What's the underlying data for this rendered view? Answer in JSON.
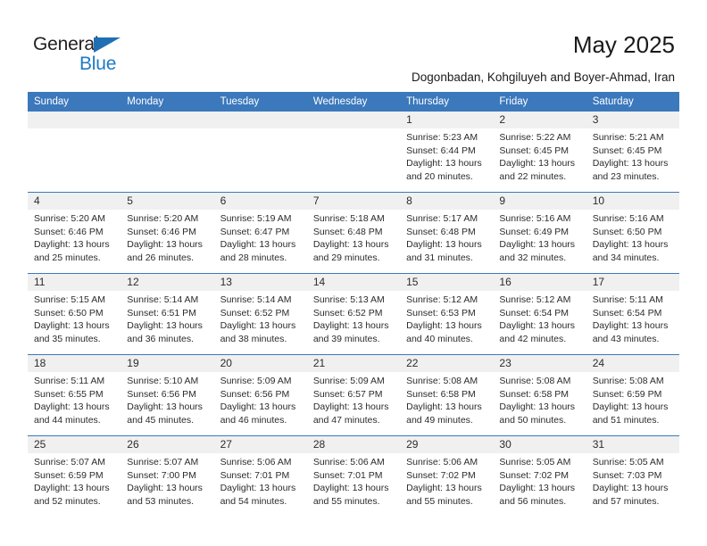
{
  "brand": {
    "name_top": "General",
    "name_bottom": "Blue",
    "accent_color": "#1f7ac4",
    "triangle_color": "#1f6fb5"
  },
  "header": {
    "title": "May 2025",
    "subtitle": "Dogonbadan, Kohgiluyeh and Boyer-Ahmad, Iran"
  },
  "calendar": {
    "header_bg": "#3b78bc",
    "daycell_bg": "#f0f0f0",
    "weekdays": [
      "Sunday",
      "Monday",
      "Tuesday",
      "Wednesday",
      "Thursday",
      "Friday",
      "Saturday"
    ],
    "weeks": [
      [
        {
          "day": "",
          "sunrise": "",
          "sunset": "",
          "daylight": "",
          "empty": true
        },
        {
          "day": "",
          "sunrise": "",
          "sunset": "",
          "daylight": "",
          "empty": true
        },
        {
          "day": "",
          "sunrise": "",
          "sunset": "",
          "daylight": "",
          "empty": true
        },
        {
          "day": "",
          "sunrise": "",
          "sunset": "",
          "daylight": "",
          "empty": true
        },
        {
          "day": "1",
          "sunrise": "Sunrise: 5:23 AM",
          "sunset": "Sunset: 6:44 PM",
          "daylight": "Daylight: 13 hours and 20 minutes."
        },
        {
          "day": "2",
          "sunrise": "Sunrise: 5:22 AM",
          "sunset": "Sunset: 6:45 PM",
          "daylight": "Daylight: 13 hours and 22 minutes."
        },
        {
          "day": "3",
          "sunrise": "Sunrise: 5:21 AM",
          "sunset": "Sunset: 6:45 PM",
          "daylight": "Daylight: 13 hours and 23 minutes."
        }
      ],
      [
        {
          "day": "4",
          "sunrise": "Sunrise: 5:20 AM",
          "sunset": "Sunset: 6:46 PM",
          "daylight": "Daylight: 13 hours and 25 minutes."
        },
        {
          "day": "5",
          "sunrise": "Sunrise: 5:20 AM",
          "sunset": "Sunset: 6:46 PM",
          "daylight": "Daylight: 13 hours and 26 minutes."
        },
        {
          "day": "6",
          "sunrise": "Sunrise: 5:19 AM",
          "sunset": "Sunset: 6:47 PM",
          "daylight": "Daylight: 13 hours and 28 minutes."
        },
        {
          "day": "7",
          "sunrise": "Sunrise: 5:18 AM",
          "sunset": "Sunset: 6:48 PM",
          "daylight": "Daylight: 13 hours and 29 minutes."
        },
        {
          "day": "8",
          "sunrise": "Sunrise: 5:17 AM",
          "sunset": "Sunset: 6:48 PM",
          "daylight": "Daylight: 13 hours and 31 minutes."
        },
        {
          "day": "9",
          "sunrise": "Sunrise: 5:16 AM",
          "sunset": "Sunset: 6:49 PM",
          "daylight": "Daylight: 13 hours and 32 minutes."
        },
        {
          "day": "10",
          "sunrise": "Sunrise: 5:16 AM",
          "sunset": "Sunset: 6:50 PM",
          "daylight": "Daylight: 13 hours and 34 minutes."
        }
      ],
      [
        {
          "day": "11",
          "sunrise": "Sunrise: 5:15 AM",
          "sunset": "Sunset: 6:50 PM",
          "daylight": "Daylight: 13 hours and 35 minutes."
        },
        {
          "day": "12",
          "sunrise": "Sunrise: 5:14 AM",
          "sunset": "Sunset: 6:51 PM",
          "daylight": "Daylight: 13 hours and 36 minutes."
        },
        {
          "day": "13",
          "sunrise": "Sunrise: 5:14 AM",
          "sunset": "Sunset: 6:52 PM",
          "daylight": "Daylight: 13 hours and 38 minutes."
        },
        {
          "day": "14",
          "sunrise": "Sunrise: 5:13 AM",
          "sunset": "Sunset: 6:52 PM",
          "daylight": "Daylight: 13 hours and 39 minutes."
        },
        {
          "day": "15",
          "sunrise": "Sunrise: 5:12 AM",
          "sunset": "Sunset: 6:53 PM",
          "daylight": "Daylight: 13 hours and 40 minutes."
        },
        {
          "day": "16",
          "sunrise": "Sunrise: 5:12 AM",
          "sunset": "Sunset: 6:54 PM",
          "daylight": "Daylight: 13 hours and 42 minutes."
        },
        {
          "day": "17",
          "sunrise": "Sunrise: 5:11 AM",
          "sunset": "Sunset: 6:54 PM",
          "daylight": "Daylight: 13 hours and 43 minutes."
        }
      ],
      [
        {
          "day": "18",
          "sunrise": "Sunrise: 5:11 AM",
          "sunset": "Sunset: 6:55 PM",
          "daylight": "Daylight: 13 hours and 44 minutes."
        },
        {
          "day": "19",
          "sunrise": "Sunrise: 5:10 AM",
          "sunset": "Sunset: 6:56 PM",
          "daylight": "Daylight: 13 hours and 45 minutes."
        },
        {
          "day": "20",
          "sunrise": "Sunrise: 5:09 AM",
          "sunset": "Sunset: 6:56 PM",
          "daylight": "Daylight: 13 hours and 46 minutes."
        },
        {
          "day": "21",
          "sunrise": "Sunrise: 5:09 AM",
          "sunset": "Sunset: 6:57 PM",
          "daylight": "Daylight: 13 hours and 47 minutes."
        },
        {
          "day": "22",
          "sunrise": "Sunrise: 5:08 AM",
          "sunset": "Sunset: 6:58 PM",
          "daylight": "Daylight: 13 hours and 49 minutes."
        },
        {
          "day": "23",
          "sunrise": "Sunrise: 5:08 AM",
          "sunset": "Sunset: 6:58 PM",
          "daylight": "Daylight: 13 hours and 50 minutes."
        },
        {
          "day": "24",
          "sunrise": "Sunrise: 5:08 AM",
          "sunset": "Sunset: 6:59 PM",
          "daylight": "Daylight: 13 hours and 51 minutes."
        }
      ],
      [
        {
          "day": "25",
          "sunrise": "Sunrise: 5:07 AM",
          "sunset": "Sunset: 6:59 PM",
          "daylight": "Daylight: 13 hours and 52 minutes."
        },
        {
          "day": "26",
          "sunrise": "Sunrise: 5:07 AM",
          "sunset": "Sunset: 7:00 PM",
          "daylight": "Daylight: 13 hours and 53 minutes."
        },
        {
          "day": "27",
          "sunrise": "Sunrise: 5:06 AM",
          "sunset": "Sunset: 7:01 PM",
          "daylight": "Daylight: 13 hours and 54 minutes."
        },
        {
          "day": "28",
          "sunrise": "Sunrise: 5:06 AM",
          "sunset": "Sunset: 7:01 PM",
          "daylight": "Daylight: 13 hours and 55 minutes."
        },
        {
          "day": "29",
          "sunrise": "Sunrise: 5:06 AM",
          "sunset": "Sunset: 7:02 PM",
          "daylight": "Daylight: 13 hours and 55 minutes."
        },
        {
          "day": "30",
          "sunrise": "Sunrise: 5:05 AM",
          "sunset": "Sunset: 7:02 PM",
          "daylight": "Daylight: 13 hours and 56 minutes."
        },
        {
          "day": "31",
          "sunrise": "Sunrise: 5:05 AM",
          "sunset": "Sunset: 7:03 PM",
          "daylight": "Daylight: 13 hours and 57 minutes."
        }
      ]
    ]
  }
}
